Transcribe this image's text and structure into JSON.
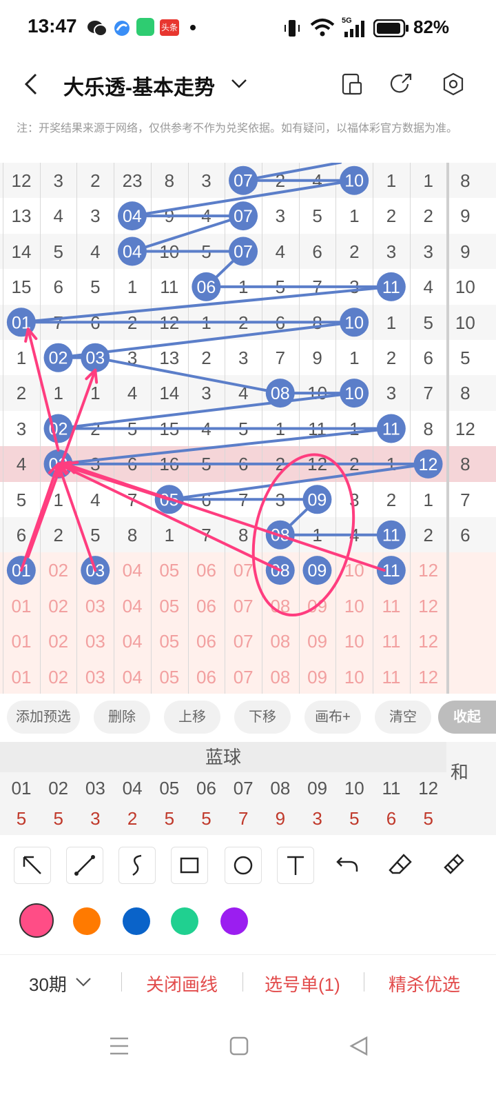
{
  "status_bar": {
    "time": "13:47",
    "badge": "头条",
    "network": "5G",
    "battery": "82%"
  },
  "header": {
    "title": "大乐透-基本走势",
    "icons": [
      "back-icon",
      "chevron-down-icon",
      "layout-icon",
      "share-icon",
      "settings-icon"
    ]
  },
  "note": "注：开奖结果来源于网络，仅供参考不作为兑奖依据。如有疑问，以福体彩官方数据为准。",
  "trend": {
    "rows": [
      [
        "12",
        "3",
        "2",
        "23",
        "8",
        "3",
        "07",
        "2",
        "4",
        "10",
        "1",
        "1",
        "8"
      ],
      [
        "13",
        "4",
        "3",
        "04",
        "9",
        "4",
        "07",
        "3",
        "5",
        "1",
        "2",
        "2",
        "9"
      ],
      [
        "14",
        "5",
        "4",
        "04",
        "10",
        "5",
        "07",
        "4",
        "6",
        "2",
        "3",
        "3",
        "9"
      ],
      [
        "15",
        "6",
        "5",
        "1",
        "11",
        "06",
        "1",
        "5",
        "7",
        "3",
        "11",
        "4",
        "10"
      ],
      [
        "01",
        "7",
        "6",
        "2",
        "12",
        "1",
        "2",
        "6",
        "8",
        "10",
        "1",
        "5",
        "10"
      ],
      [
        "1",
        "02",
        "03",
        "3",
        "13",
        "2",
        "3",
        "7",
        "9",
        "1",
        "2",
        "6",
        "5"
      ],
      [
        "2",
        "1",
        "1",
        "4",
        "14",
        "3",
        "4",
        "08",
        "10",
        "10",
        "3",
        "7",
        "8"
      ],
      [
        "3",
        "02",
        "2",
        "5",
        "15",
        "4",
        "5",
        "1",
        "11",
        "1",
        "11",
        "8",
        "12"
      ],
      [
        "4",
        "02",
        "3",
        "6",
        "16",
        "5",
        "6",
        "2",
        "12",
        "2",
        "1",
        "12",
        "8"
      ],
      [
        "5",
        "1",
        "4",
        "7",
        "05",
        "6",
        "7",
        "3",
        "09",
        "3",
        "2",
        "1",
        "7"
      ],
      [
        "6",
        "2",
        "5",
        "8",
        "1",
        "7",
        "8",
        "08",
        "1",
        "4",
        "11",
        "2",
        "6"
      ]
    ],
    "balls": [
      [
        0,
        6
      ],
      [
        0,
        9
      ],
      [
        1,
        3
      ],
      [
        1,
        6
      ],
      [
        2,
        3
      ],
      [
        2,
        6
      ],
      [
        3,
        5
      ],
      [
        3,
        10
      ],
      [
        4,
        0
      ],
      [
        4,
        9
      ],
      [
        5,
        1
      ],
      [
        5,
        2
      ],
      [
        6,
        7
      ],
      [
        6,
        9
      ],
      [
        7,
        1
      ],
      [
        7,
        10
      ],
      [
        8,
        1
      ],
      [
        8,
        11
      ],
      [
        9,
        4
      ],
      [
        9,
        8
      ],
      [
        10,
        7
      ],
      [
        10,
        10
      ]
    ],
    "pick_rows": [
      [
        "01",
        "02",
        "03",
        "04",
        "05",
        "06",
        "07",
        "08",
        "09",
        "10",
        "11",
        "12"
      ],
      [
        "01",
        "02",
        "03",
        "04",
        "05",
        "06",
        "07",
        "08",
        "09",
        "10",
        "11",
        "12"
      ],
      [
        "01",
        "02",
        "03",
        "04",
        "05",
        "06",
        "07",
        "08",
        "09",
        "10",
        "11",
        "12"
      ],
      [
        "01",
        "02",
        "03",
        "04",
        "05",
        "06",
        "07",
        "08",
        "09",
        "10",
        "11",
        "12"
      ]
    ],
    "pick_selected": [
      0,
      2,
      7,
      8,
      10
    ]
  },
  "actions": {
    "add_preselect": "添加预选",
    "delete": "删除",
    "move_up": "上移",
    "move_down": "下移",
    "canvas_plus": "画布+",
    "clear": "清空",
    "collapse": "收起"
  },
  "blue_ball": {
    "title": "蓝球",
    "sum_label": "和",
    "numbers": [
      "01",
      "02",
      "03",
      "04",
      "05",
      "06",
      "07",
      "08",
      "09",
      "10",
      "11",
      "12"
    ],
    "counts": [
      "5",
      "5",
      "3",
      "2",
      "5",
      "5",
      "7",
      "9",
      "3",
      "5",
      "6",
      "5"
    ]
  },
  "colors": {
    "ball": "#5b7ec9",
    "draw_pink": "#ff3d7f",
    "swatches": [
      "#ff4d86",
      "#ff7a00",
      "#0a63c9",
      "#20d090",
      "#9b1ef0"
    ]
  },
  "tools": [
    "arrow-icon",
    "line-icon",
    "freehand-icon",
    "rectangle-icon",
    "circle-icon",
    "text-icon",
    "undo-icon",
    "eraser-icon",
    "brush-icon"
  ],
  "bottom": {
    "period": "30期",
    "close_drawing": "关闭画线",
    "pick_list": "选号单(1)",
    "select_best": "精杀优选"
  }
}
